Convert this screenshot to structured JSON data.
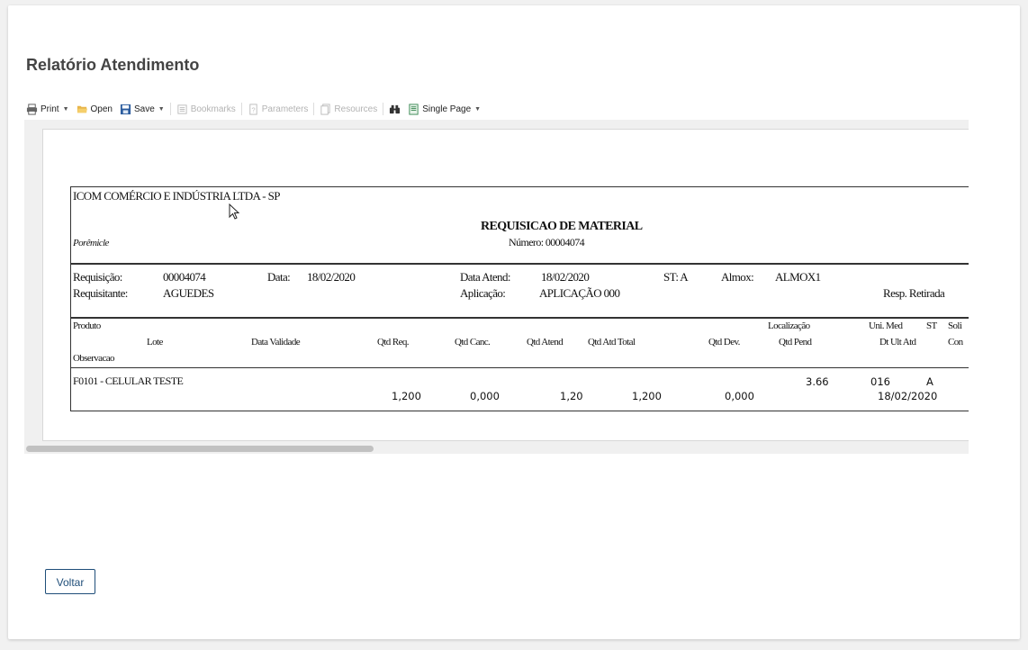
{
  "page": {
    "title": "Relatório Atendimento"
  },
  "toolbar": {
    "print": "Print",
    "open": "Open",
    "save": "Save",
    "bookmarks": "Bookmarks",
    "parameters": "Parameters",
    "resources": "Resources",
    "view_mode": "Single Page"
  },
  "report": {
    "company": "ICOM COMÉRCIO E INDÚSTRIA LTDA - SP",
    "subtitle": "Porêmicle",
    "title": "REQUISICAO DE MATERIAL",
    "number": "Número: 00004074",
    "info": {
      "req_label": "Requisição:",
      "req_value": "00004074",
      "data_label": "Data:",
      "data_value": "18/02/2020",
      "data_atend_label": "Data Atend:",
      "data_atend_value": "18/02/2020",
      "st_label": "ST: A",
      "almox_label": "Almox:",
      "almox_value": "ALMOX1",
      "requisitante_label": "Requisitante:",
      "requisitante_value": "AGUEDES",
      "aplicacao_label": "Aplicação:",
      "aplicacao_value": "APLICAÇÃO 000",
      "resp_label": "Resp. Retirada"
    },
    "headers": {
      "produto": "Produto",
      "lote": "Lote",
      "data_validade": "Data Validade",
      "observacao": "Observacao",
      "qtd_req": "Qtd Req.",
      "qtd_canc": "Qtd Canc.",
      "qtd_atend": "Qtd Atend",
      "qtd_atd_total": "Qtd Atd Total",
      "qtd_dev": "Qtd Dev.",
      "localizacao": "Localização",
      "qtd_pend": "Qtd Pend",
      "uni_med": "Uni. Med",
      "st": "ST",
      "soli": "Soli",
      "dt_ult_atd": "Dt Ult Atd",
      "con": "Con"
    },
    "row": {
      "produto": "F0101 - CELULAR TESTE",
      "qtd_req": "1,200",
      "qtd_canc": "0,000",
      "qtd_atend": "1,20",
      "qtd_atd_total": "1,200",
      "qtd_dev": "0,000",
      "qtd_pend": "3.66",
      "uni_med": "016",
      "st": "A",
      "dt_ult_atd": "18/02/2020"
    }
  },
  "footer": {
    "back_button": "Voltar"
  }
}
